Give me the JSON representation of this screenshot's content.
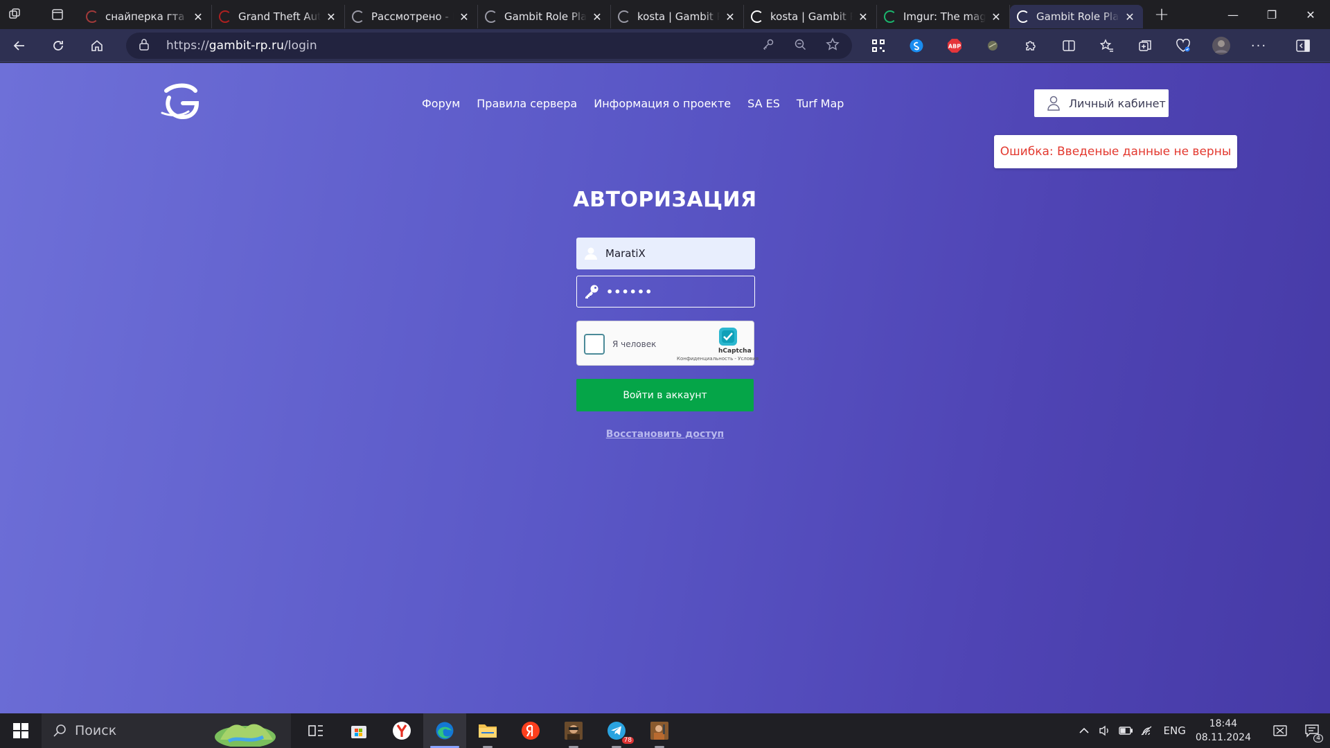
{
  "browser": {
    "tabs": [
      {
        "title": "снайперка гта са",
        "favicon_color": "#a33a3a"
      },
      {
        "title": "Grand Theft Auto",
        "favicon_color": "#b02020"
      },
      {
        "title": "Рассмотрено - M",
        "favicon_color": "#9a9aa6"
      },
      {
        "title": "Gambit Role Play",
        "favicon_color": "#9a9aa6"
      },
      {
        "title": "kosta | Gambit Ro",
        "favicon_color": "#9a9aa6"
      },
      {
        "title": "kosta | Gambit Ro",
        "favicon_color": "#ffffff"
      },
      {
        "title": "Imgur: The magic",
        "favicon_color": "#1bb76e"
      },
      {
        "title": "Gambit Role Play",
        "favicon_color": "#ffffff",
        "active": true
      }
    ],
    "url": {
      "scheme": "https://",
      "host": "gambit-rp.ru",
      "path": "/login"
    },
    "extensions": [
      "qr-icon",
      "shazam-icon",
      "adblock-icon",
      "extension-orb-icon",
      "puzzle-icon",
      "split-screen-icon",
      "favorites-icon",
      "collections-icon",
      "heart-shield-icon",
      "profile-avatar",
      "more-icon",
      "sidebar-icon"
    ],
    "adblock_label": "ABP"
  },
  "site": {
    "nav": [
      "Форум",
      "Правила сервера",
      "Информация о проекте",
      "SA ES",
      "Turf Map"
    ],
    "cabinet_label": "Личный кабинет",
    "error_message": "Ошибка: Введеные данные не верны",
    "title": "АВТОРИЗАЦИЯ",
    "username_value": "MaratiX",
    "password_value": "••••••",
    "captcha": {
      "label": "Я человек",
      "brand": "hCaptcha",
      "links": "Конфиденциальность - Условия"
    },
    "login_button": "Войти в аккаунт",
    "restore_link": "Восстановить доступ"
  },
  "taskbar": {
    "search_placeholder": "Поиск",
    "lang": "ENG",
    "time": "18:44",
    "date": "08.11.2024",
    "telegram_badge": "78",
    "notifications_badge": "4"
  },
  "colors": {
    "page_accent": "#5a57c6",
    "login_green": "#05a548",
    "error_red": "#e3392f"
  }
}
